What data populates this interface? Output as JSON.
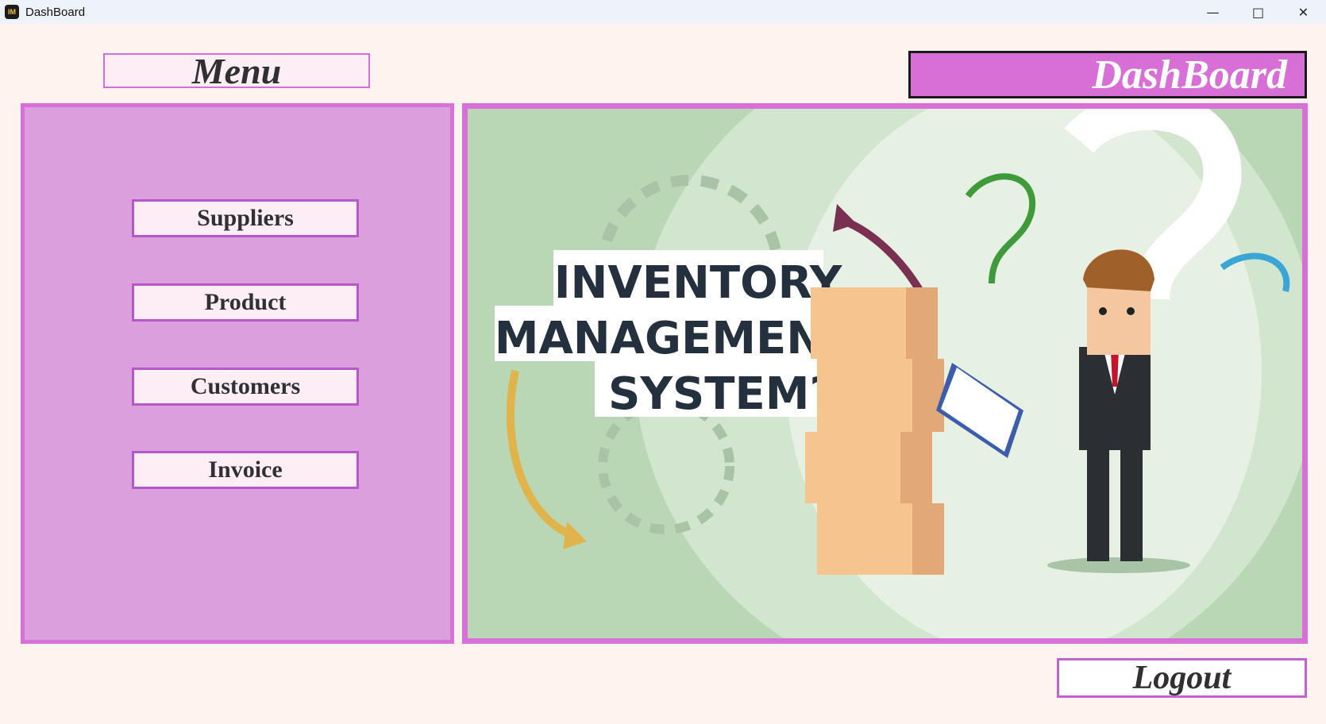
{
  "window": {
    "title": "DashBoard",
    "icon_name": "app-logo-icon",
    "icon_text": "IM",
    "controls": [
      "minimize-icon",
      "maximize-icon",
      "close-icon"
    ]
  },
  "header": {
    "menu_label": "Menu",
    "dashboard_label": "DashBoard"
  },
  "menu": {
    "items": [
      {
        "label": "Suppliers"
      },
      {
        "label": "Product"
      },
      {
        "label": "Customers"
      },
      {
        "label": "Invoice"
      }
    ]
  },
  "banner": {
    "lines": [
      "INVENTORY",
      "MANAGEMENT",
      "SYSTEM?"
    ]
  },
  "footer": {
    "logout_label": "Logout"
  },
  "colors": {
    "background": "#fff3ef",
    "accent": "#d870d8",
    "menu_panel": "#dc9fdd",
    "button_fill": "#fdeef6"
  }
}
